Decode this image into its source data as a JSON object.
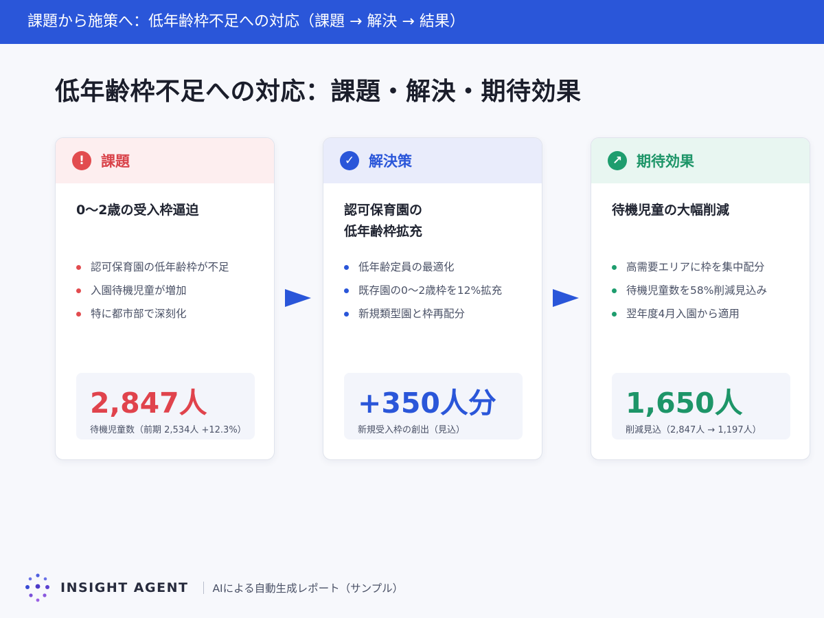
{
  "header": {
    "title": "課題から施策へ：低年齢枠不足への対応（課題 → 解決 → 結果）"
  },
  "main": {
    "title": "低年齢枠不足への対応：課題・解決・期待効果"
  },
  "cards": [
    {
      "badge": "!",
      "badge_icon": "exclamation-icon",
      "title": "課題",
      "subtitle": "0〜2歳の受入枠逼迫",
      "bullets": [
        "認可保育園の低年齢枠が不足",
        "入園待機児童が増加",
        "特に都市部で深刻化"
      ],
      "metric_value": "2,847人",
      "metric_caption": "待機児童数（前期 2,534人 +12.3%）",
      "accent": "#e24c4f"
    },
    {
      "badge": "✓",
      "badge_icon": "check-icon",
      "title": "解決策",
      "subtitle_lines": [
        "認可保育園の",
        "低年齢枠拡充"
      ],
      "bullets": [
        "低年齢定員の最適化",
        "既存園の0〜2歳枠を12%拡充",
        "新規類型園と枠再配分"
      ],
      "metric_value": "+350人分",
      "metric_caption": "新規受入枠の創出（見込）",
      "accent": "#2a56d9"
    },
    {
      "badge": "↗",
      "badge_icon": "trend-up-icon",
      "title": "期待効果",
      "subtitle": "待機児童の大幅削減",
      "bullets": [
        "高需要エリアに枠を集中配分",
        "待機児童数を58%削減見込み",
        "翌年度4月入園から適用"
      ],
      "metric_value": "1,650人",
      "metric_caption": "削減見込（2,847人 → 1,197人）",
      "accent": "#1e9d6e"
    }
  ],
  "arrows": {
    "icon": "arrow-right-icon",
    "color": "#2a56d9"
  },
  "footer": {
    "brand": "INSIGHT AGENT",
    "tagline": "AIによる自動生成レポート（サンプル）",
    "logo_icon": "dots-logo-icon"
  }
}
